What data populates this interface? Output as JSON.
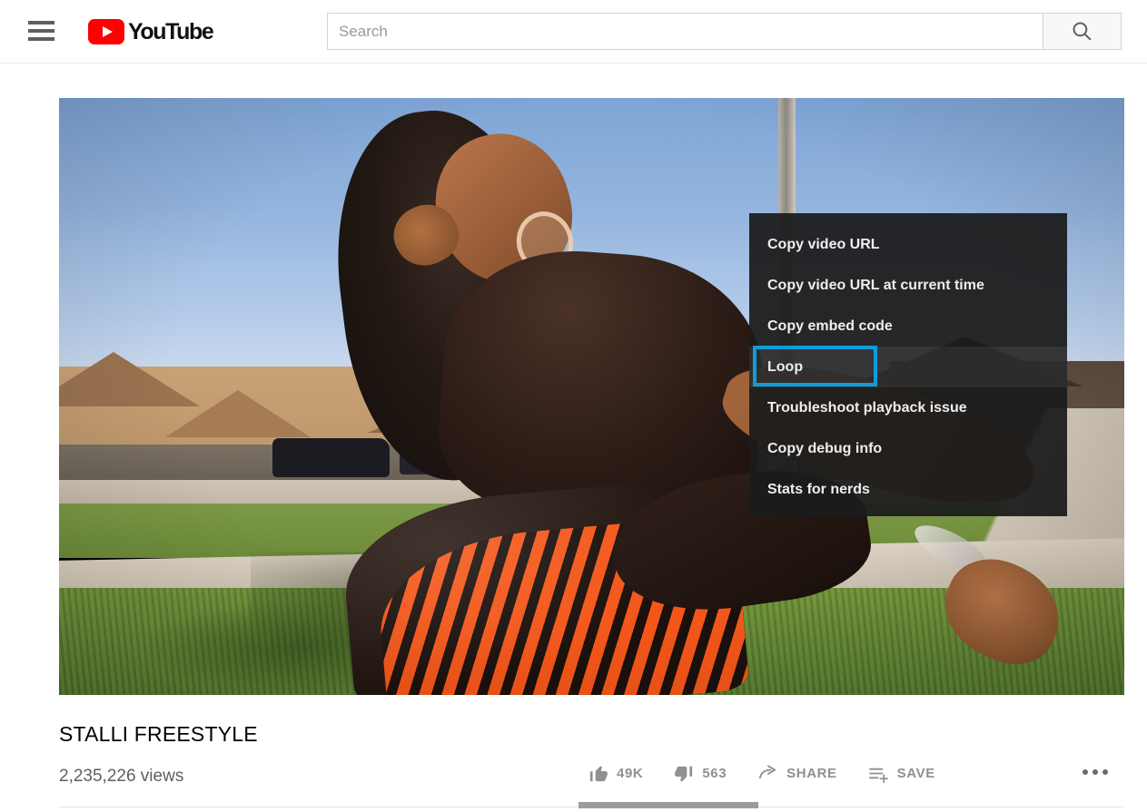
{
  "header": {
    "menu_icon": "hamburger-icon",
    "logo_text": "YouTube",
    "logo_color": "#ff0000",
    "search": {
      "placeholder": "Search",
      "value": "",
      "button_icon": "search-icon"
    }
  },
  "player": {
    "context_menu": {
      "items": [
        {
          "label": "Copy video URL",
          "highlighted": false
        },
        {
          "label": "Copy video URL at current time",
          "highlighted": false
        },
        {
          "label": "Copy embed code",
          "highlighted": false
        },
        {
          "label": "Loop",
          "highlighted": true
        },
        {
          "label": "Troubleshoot playback issue",
          "highlighted": false
        },
        {
          "label": "Copy debug info",
          "highlighted": false
        },
        {
          "label": "Stats for nerds",
          "highlighted": false
        }
      ],
      "highlight_color": "#0d9ddb",
      "background_color": "#1c1c1c"
    }
  },
  "video": {
    "title": "STALLI FREESTYLE",
    "views": "2,235,226 views"
  },
  "actions": [
    {
      "name": "like",
      "icon": "thumbs-up-icon",
      "label": "49K"
    },
    {
      "name": "dislike",
      "icon": "thumbs-down-icon",
      "label": "563"
    },
    {
      "name": "share",
      "icon": "share-arrow-icon",
      "label": "SHARE"
    },
    {
      "name": "save",
      "icon": "add-to-playlist-icon",
      "label": "SAVE"
    }
  ],
  "more_menu": {
    "icon": "ellipsis-icon"
  }
}
